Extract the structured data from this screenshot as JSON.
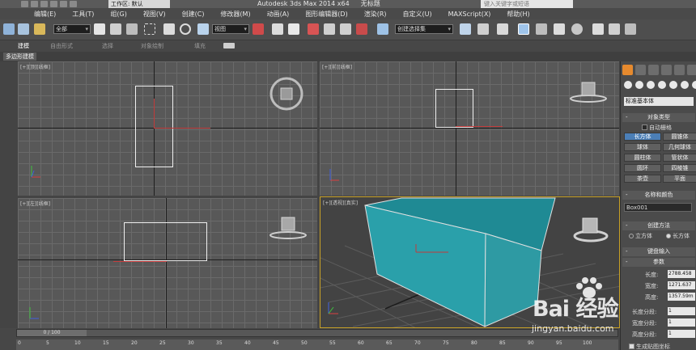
{
  "titlebar": {
    "workspace": "工作区: 默认",
    "title": "Autodesk 3ds Max  2014 x64",
    "doc": "无标题",
    "search_placeholder": "键入关键字或短语"
  },
  "menu": [
    "编辑(E)",
    "工具(T)",
    "组(G)",
    "视图(V)",
    "创建(C)",
    "修改器(M)",
    "动画(A)",
    "图形编辑器(D)",
    "渲染(R)",
    "自定义(U)",
    "MAXScript(X)",
    "帮助(H)"
  ],
  "toolbar": {
    "selection_filter": "全部",
    "ref_coord": "视图",
    "named_selection": "创建选择集"
  },
  "ribbon": {
    "tabs": [
      "建模",
      "自由形式",
      "选择",
      "对象绘制",
      "填充"
    ],
    "active": "建模",
    "sub_label": "多边形建模"
  },
  "viewports": {
    "top": "[+][顶][线框]",
    "front": "[+][前][线框]",
    "left": "[+][左][线框]",
    "perspective": "[+][透视][真实]"
  },
  "timeline": {
    "position": "0 / 100",
    "ticks": [
      "0",
      "5",
      "10",
      "15",
      "20",
      "25",
      "30",
      "35",
      "40",
      "45",
      "50",
      "55",
      "60",
      "65",
      "70",
      "75",
      "80",
      "85",
      "90",
      "95",
      "100"
    ]
  },
  "panel": {
    "category": "标准基本体",
    "object_type_title": "对象类型",
    "autogrid": "自动栅格",
    "buttons": [
      {
        "left": "长方体",
        "right": "圆锥体"
      },
      {
        "left": "球体",
        "right": "几何球体"
      },
      {
        "left": "圆柱体",
        "right": "管状体"
      },
      {
        "left": "圆环",
        "right": "四棱锥"
      },
      {
        "left": "茶壶",
        "right": "平面"
      }
    ],
    "name_color_title": "名称和颜色",
    "object_name": "Box001",
    "creation_method_title": "创建方法",
    "method_cube": "立方体",
    "method_box": "长方体",
    "keyboard_title": "键盘输入",
    "params_title": "参数",
    "length_label": "长度:",
    "length_value": "2788.458",
    "width_label": "宽度:",
    "width_value": "1271.637",
    "height_label": "高度:",
    "height_value": "1357.59m",
    "length_segs_label": "长度分段:",
    "length_segs": "1",
    "width_segs_label": "宽度分段:",
    "width_segs": "1",
    "height_segs_label": "高度分段:",
    "height_segs": "1",
    "gen_mapping": "生成贴图坐标"
  },
  "watermark": {
    "brand": "Bai 经验",
    "url": "jingyan.baidu.com"
  },
  "colors": {
    "box_cyan": "#2aa0aa",
    "panel_highlight": "#4b7fb7",
    "active_border": "#c9a227"
  }
}
